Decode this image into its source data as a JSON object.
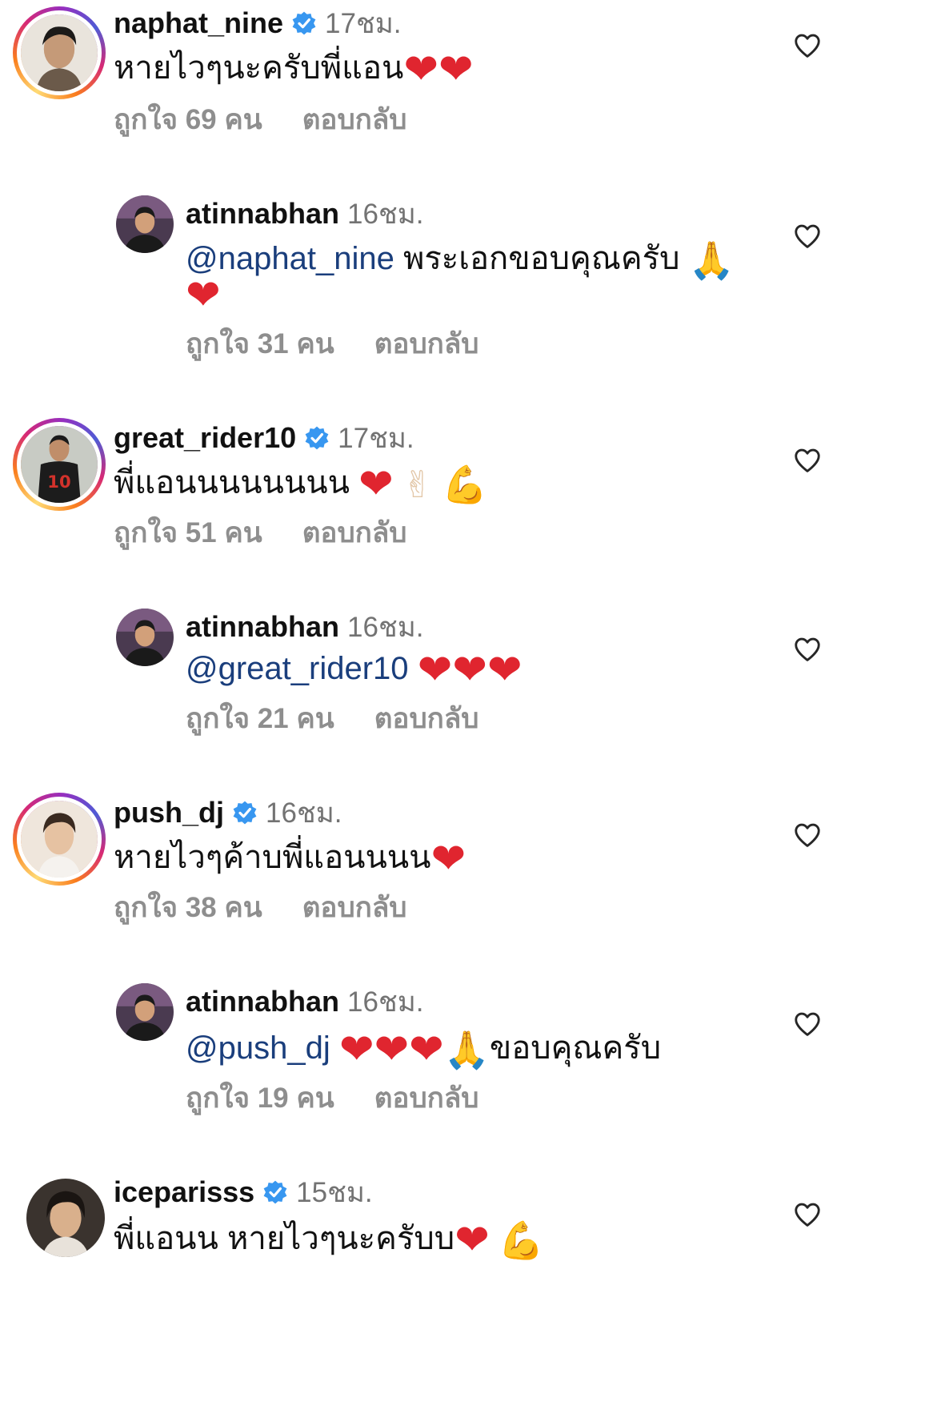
{
  "comments": [
    {
      "username": "naphat_nine",
      "time": "17ชม.",
      "text": "หายไวๆนะครับพี่แอน",
      "emojis": [
        "❤",
        "❤"
      ],
      "likes": "ถูกใจ 69 คน",
      "reply": "ตอบกลับ",
      "verified": true
    },
    {
      "username": "atinnabhan",
      "time": "16ชม.",
      "mention": "@naphat_nine",
      "text": "พระเอกขอบคุณครับ",
      "emojis_inline": [
        "🙏"
      ],
      "emojis_line2": [
        "❤"
      ],
      "likes": "ถูกใจ 31 คน",
      "reply": "ตอบกลับ",
      "verified": false
    },
    {
      "username": "great_rider10",
      "time": "17ชม.",
      "text": "พี่แอนนนนนนนน",
      "emojis": [
        "❤",
        "✌",
        "💪"
      ],
      "likes": "ถูกใจ 51 คน",
      "reply": "ตอบกลับ",
      "verified": true
    },
    {
      "username": "atinnabhan",
      "time": "16ชม.",
      "mention": "@great_rider10",
      "emojis": [
        "❤",
        "❤",
        "❤"
      ],
      "likes": "ถูกใจ 21 คน",
      "reply": "ตอบกลับ",
      "verified": false
    },
    {
      "username": "push_dj",
      "time": "16ชม.",
      "text": "หายไวๆค้าบพี่แอนนนน",
      "emojis": [
        "❤"
      ],
      "likes": "ถูกใจ 38 คน",
      "reply": "ตอบกลับ",
      "verified": true
    },
    {
      "username": "atinnabhan",
      "time": "16ชม.",
      "mention": "@push_dj",
      "emojis": [
        "❤",
        "❤",
        "❤",
        "🙏"
      ],
      "text_after": "ขอบคุณครับ",
      "likes": "ถูกใจ 19 คน",
      "reply": "ตอบกลับ",
      "verified": false
    },
    {
      "username": "iceparisss",
      "time": "15ชม.",
      "text": "พี่แอนน หายไวๆนะครับบ",
      "emojis": [
        "❤",
        "💪"
      ],
      "verified": true
    }
  ],
  "colors": {
    "mention": "#1a3e7c",
    "verified": "#3897f0",
    "heart": "#e0252f",
    "muted": "#8e8e8e"
  },
  "icons": {
    "verified": "verified-badge-icon",
    "like": "heart-outline-icon"
  }
}
